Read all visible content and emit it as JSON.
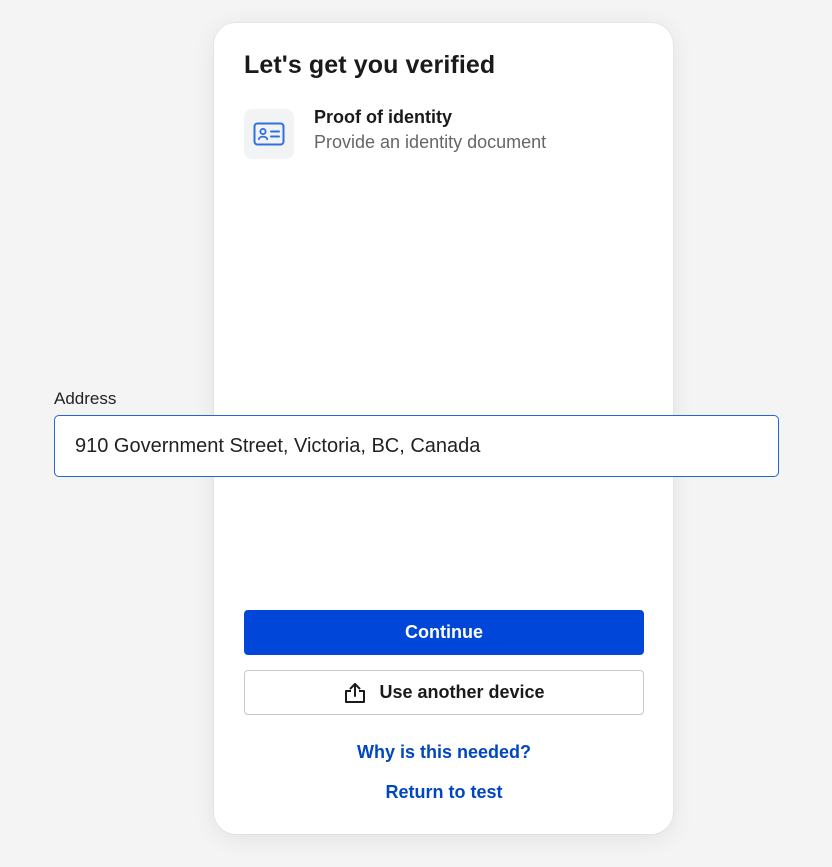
{
  "card": {
    "title": "Let's get you verified",
    "step": {
      "icon": "id-card-icon",
      "title": "Proof of identity",
      "subtitle": "Provide an identity document"
    },
    "buttons": {
      "continue_label": "Continue",
      "other_device_label": "Use another device",
      "other_device_icon": "upload-icon"
    },
    "links": {
      "why_label": "Why is this needed?",
      "return_label": "Return to test"
    }
  },
  "address": {
    "label": "Address",
    "value": "910 Government Street, Victoria, BC, Canada"
  },
  "colors": {
    "primary": "#0047d9",
    "link": "#0047c0",
    "icon": "#2f6fe0",
    "input_border": "#1f66d6"
  }
}
